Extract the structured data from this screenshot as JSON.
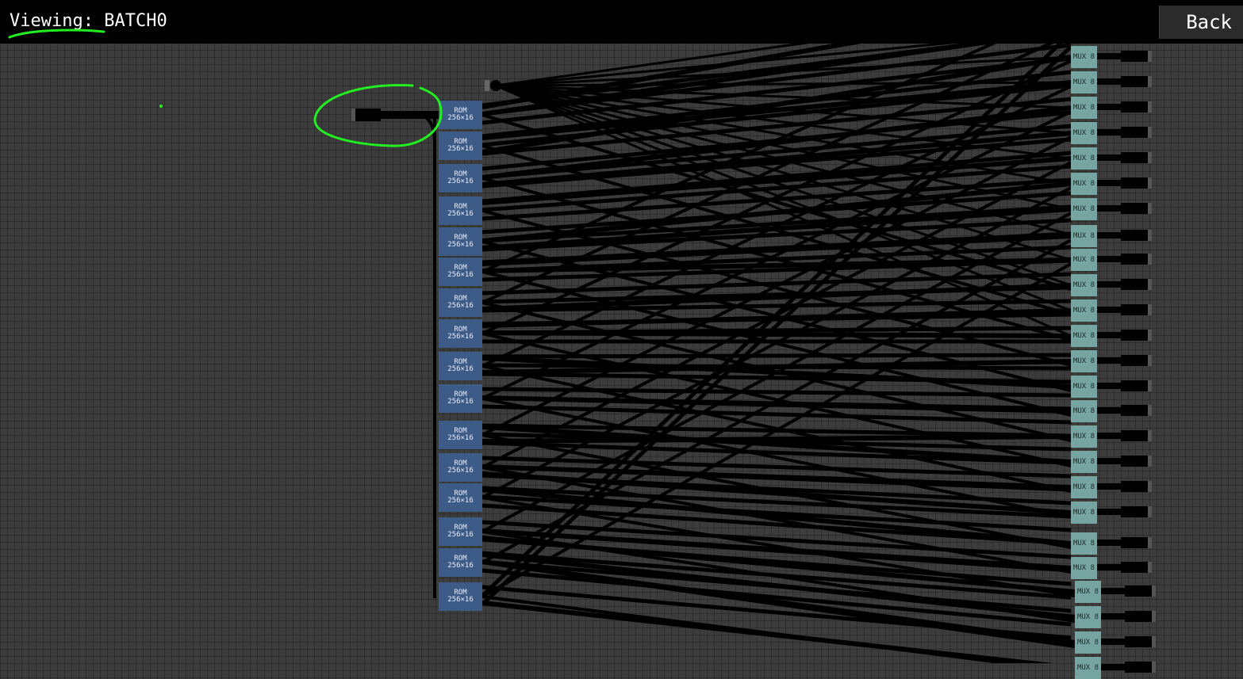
{
  "header": {
    "viewing_label": "Viewing:",
    "batch_name": "BATCH0",
    "back_label": "Back"
  },
  "rom_blocks": [
    {
      "line1": "ROM",
      "line2": "256×16"
    },
    {
      "line1": "ROM",
      "line2": "256×16"
    },
    {
      "line1": "ROM",
      "line2": "256×16"
    },
    {
      "line1": "ROM",
      "line2": "256×16"
    },
    {
      "line1": "ROM",
      "line2": "256×16"
    },
    {
      "line1": "ROM",
      "line2": "256×16"
    },
    {
      "line1": "ROM",
      "line2": "256×16"
    },
    {
      "line1": "ROM",
      "line2": "256×16"
    },
    {
      "line1": "ROM",
      "line2": "256×16"
    },
    {
      "line1": "ROM",
      "line2": "256×16"
    },
    {
      "line1": "ROM",
      "line2": "256×16"
    },
    {
      "line1": "ROM",
      "line2": "256×16"
    },
    {
      "line1": "ROM",
      "line2": "256×16"
    },
    {
      "line1": "ROM",
      "line2": "256×16"
    },
    {
      "line1": "ROM",
      "line2": "256×16"
    },
    {
      "line1": "ROM",
      "line2": "256×16"
    }
  ],
  "mux_label": "MUX 8",
  "colors": {
    "background": "#3c3c3c",
    "topbar": "#000000",
    "rom": "#3d5b87",
    "mux": "#76a4a1",
    "wire": "#000000",
    "annotation": "#22ee22"
  }
}
